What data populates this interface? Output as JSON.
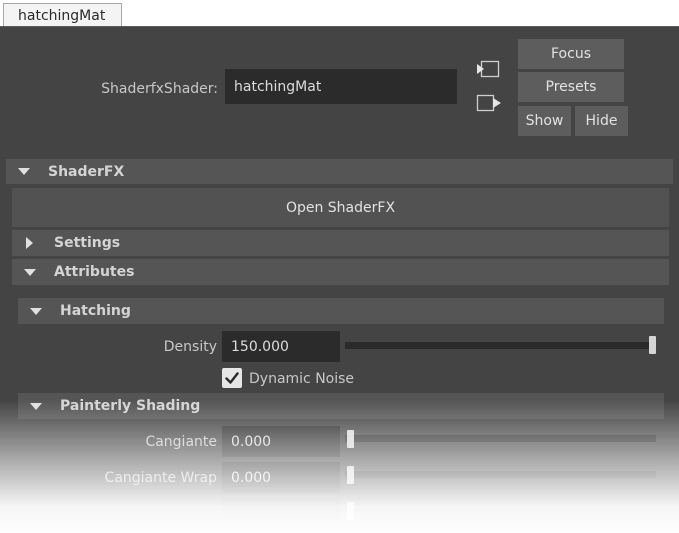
{
  "tab": {
    "label": "hatchingMat"
  },
  "shader": {
    "type_label": "ShaderfxShader:",
    "name_value": "hatchingMat"
  },
  "buttons": {
    "focus": "Focus",
    "presets": "Presets",
    "show": "Show",
    "hide": "Hide"
  },
  "sections": {
    "shaderfx": "ShaderFX",
    "open_shaderfx": "Open ShaderFX",
    "settings": "Settings",
    "attributes": "Attributes",
    "hatching": "Hatching",
    "painterly": "Painterly Shading"
  },
  "hatching": {
    "density_label": "Density",
    "density_value": "150.000",
    "density_slider": 1.0,
    "dynamic_noise_label": "Dynamic Noise",
    "dynamic_noise_checked": true
  },
  "painterly": {
    "cangiante_label": "Cangiante",
    "cangiante_value": "0.000",
    "cangiante_wrap_label": "Cangiante Wrap",
    "cangiante_wrap_value": "0.000"
  },
  "icons": [
    "input-connection-icon",
    "output-connection-icon",
    "collapse-triangle-icon",
    "expand-triangle-icon",
    "checkmark-icon"
  ],
  "colors": {
    "panel_bg": "#444444",
    "section_bg": "#555555",
    "field_bg": "#2b2b2b",
    "button_bg": "#5d5d5d"
  }
}
